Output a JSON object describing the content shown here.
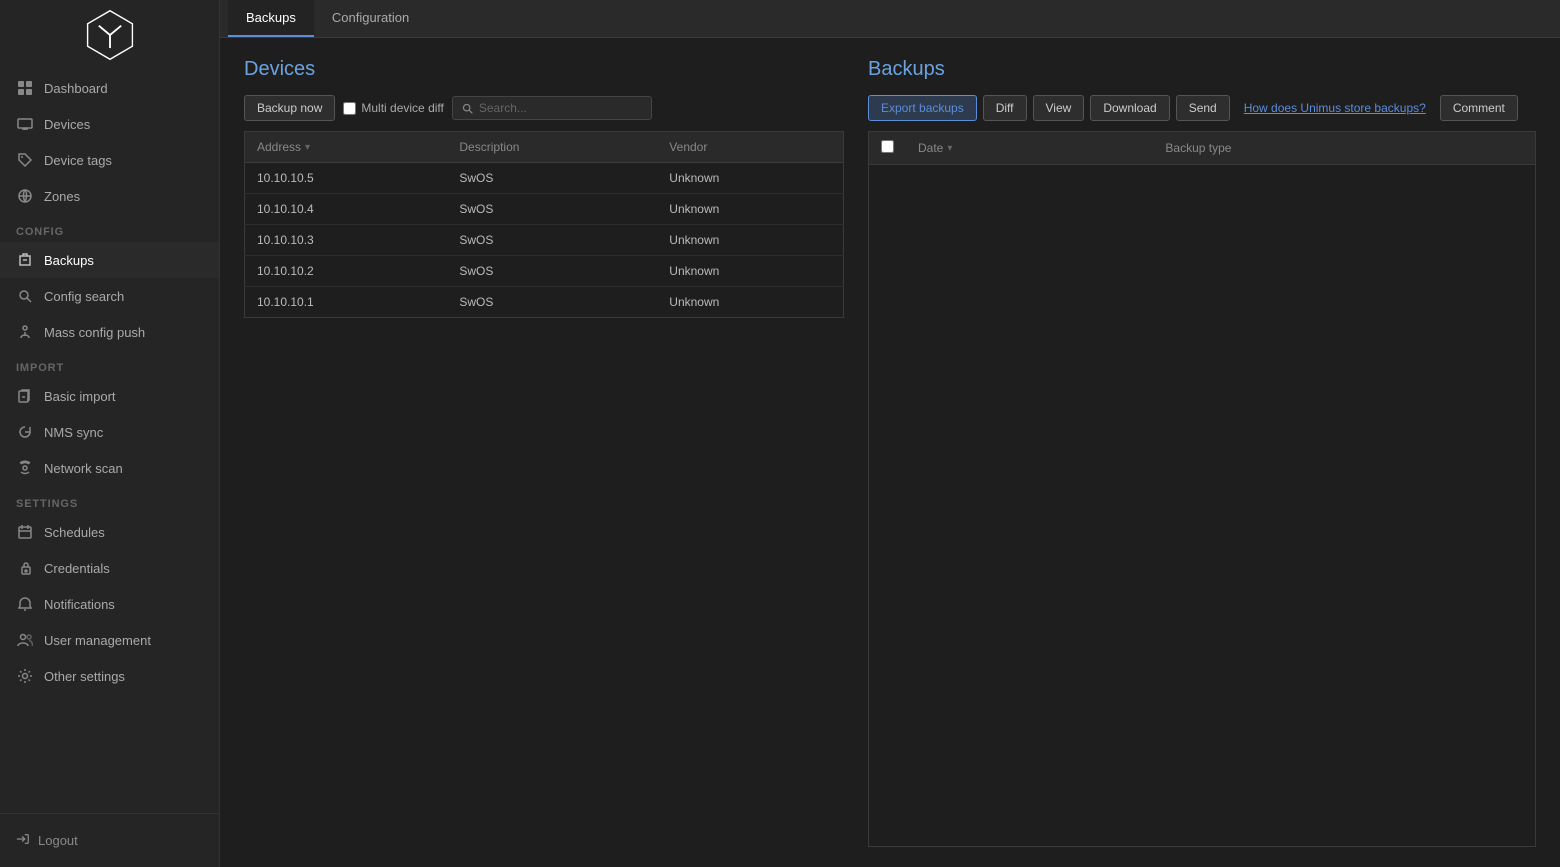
{
  "sidebar": {
    "logo_alt": "Unimus logo",
    "nav_items": [
      {
        "id": "dashboard",
        "label": "Dashboard",
        "icon": "dashboard-icon",
        "section": null
      },
      {
        "id": "devices",
        "label": "Devices",
        "icon": "devices-icon",
        "section": null
      },
      {
        "id": "device-tags",
        "label": "Device tags",
        "icon": "tag-icon",
        "section": null
      },
      {
        "id": "zones",
        "label": "Zones",
        "icon": "zones-icon",
        "section": null
      },
      {
        "id": "backups",
        "label": "Backups",
        "icon": "backups-icon",
        "section": "CONFIG",
        "active": true
      },
      {
        "id": "config-search",
        "label": "Config search",
        "icon": "search-icon",
        "section": null
      },
      {
        "id": "mass-config-push",
        "label": "Mass config push",
        "icon": "push-icon",
        "section": null
      },
      {
        "id": "basic-import",
        "label": "Basic import",
        "icon": "import-icon",
        "section": "IMPORT"
      },
      {
        "id": "nms-sync",
        "label": "NMS sync",
        "icon": "sync-icon",
        "section": null
      },
      {
        "id": "network-scan",
        "label": "Network scan",
        "icon": "scan-icon",
        "section": null
      },
      {
        "id": "schedules",
        "label": "Schedules",
        "icon": "schedules-icon",
        "section": "SETTINGS"
      },
      {
        "id": "credentials",
        "label": "Credentials",
        "icon": "credentials-icon",
        "section": null
      },
      {
        "id": "notifications",
        "label": "Notifications",
        "icon": "notifications-icon",
        "section": null
      },
      {
        "id": "user-management",
        "label": "User management",
        "icon": "users-icon",
        "section": null
      },
      {
        "id": "other-settings",
        "label": "Other settings",
        "icon": "settings-icon",
        "section": null
      }
    ],
    "logout_label": "Logout"
  },
  "tabs": [
    {
      "id": "backups",
      "label": "Backups",
      "active": true
    },
    {
      "id": "configuration",
      "label": "Configuration",
      "active": false
    }
  ],
  "devices_panel": {
    "title": "Devices",
    "backup_now_label": "Backup now",
    "multi_device_diff_label": "Multi device diff",
    "search_placeholder": "Search...",
    "columns": [
      {
        "id": "address",
        "label": "Address"
      },
      {
        "id": "description",
        "label": "Description"
      },
      {
        "id": "vendor",
        "label": "Vendor"
      }
    ],
    "rows": [
      {
        "address": "10.10.10.5",
        "description": "SwOS",
        "vendor": "Unknown"
      },
      {
        "address": "10.10.10.4",
        "description": "SwOS",
        "vendor": "Unknown"
      },
      {
        "address": "10.10.10.3",
        "description": "SwOS",
        "vendor": "Unknown"
      },
      {
        "address": "10.10.10.2",
        "description": "SwOS",
        "vendor": "Unknown"
      },
      {
        "address": "10.10.10.1",
        "description": "SwOS",
        "vendor": "Unknown"
      }
    ]
  },
  "backups_panel": {
    "title": "Backups",
    "export_backups_label": "Export backups",
    "diff_label": "Diff",
    "view_label": "View",
    "download_label": "Download",
    "send_label": "Send",
    "how_does_link_label": "How does Unimus store backups?",
    "comment_label": "Comment",
    "columns": [
      {
        "id": "date",
        "label": "Date"
      },
      {
        "id": "backup-type",
        "label": "Backup type"
      }
    ],
    "rows": []
  }
}
